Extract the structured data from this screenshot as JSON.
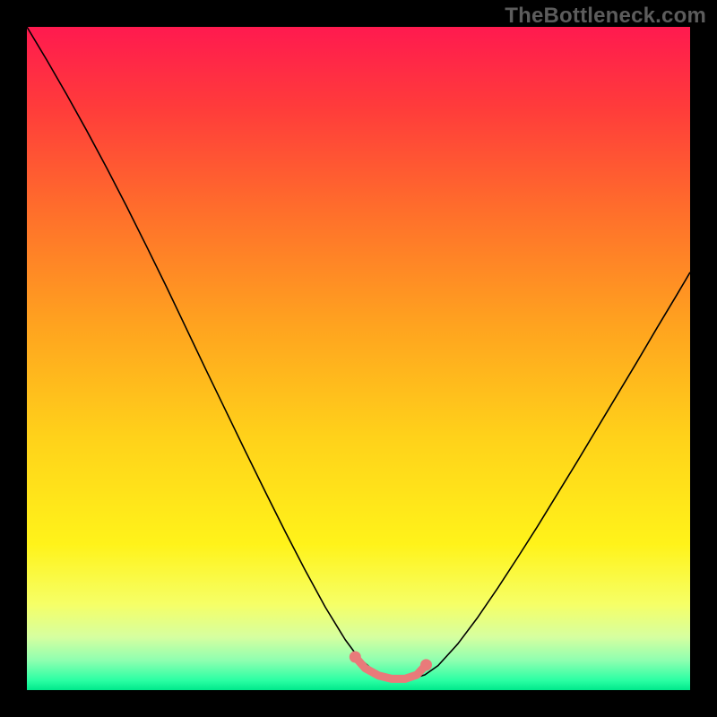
{
  "watermark": "TheBottleneck.com",
  "chart_data": {
    "type": "line",
    "title": "",
    "xlabel": "",
    "ylabel": "",
    "xlim": [
      0,
      100
    ],
    "ylim": [
      0,
      100
    ],
    "grid": false,
    "legend": false,
    "background_gradient": {
      "stops": [
        {
          "offset": 0.0,
          "color": "#ff1a4f"
        },
        {
          "offset": 0.12,
          "color": "#ff3b3b"
        },
        {
          "offset": 0.28,
          "color": "#ff6f2b"
        },
        {
          "offset": 0.45,
          "color": "#ffa31f"
        },
        {
          "offset": 0.62,
          "color": "#ffd21a"
        },
        {
          "offset": 0.78,
          "color": "#fff31a"
        },
        {
          "offset": 0.87,
          "color": "#f6ff66"
        },
        {
          "offset": 0.92,
          "color": "#d6ffa0"
        },
        {
          "offset": 0.955,
          "color": "#8fffb0"
        },
        {
          "offset": 0.985,
          "color": "#2cffa4"
        },
        {
          "offset": 1.0,
          "color": "#00e88b"
        }
      ]
    },
    "series": [
      {
        "name": "bottleneck-curve",
        "stroke": "#000000",
        "stroke_width": 1.6,
        "x": [
          0.0,
          3.0,
          6.0,
          9.0,
          12.0,
          15.0,
          18.0,
          21.0,
          24.0,
          27.0,
          30.0,
          33.0,
          36.0,
          39.0,
          42.0,
          45.0,
          48.0,
          50.0,
          52.0,
          54.0,
          56.0,
          58.0,
          60.0,
          62.0,
          65.0,
          68.0,
          71.0,
          74.0,
          77.0,
          80.0,
          83.0,
          86.0,
          89.0,
          92.0,
          95.0,
          98.0,
          100.0
        ],
        "y": [
          100.0,
          95.0,
          89.8,
          84.4,
          78.8,
          73.0,
          67.0,
          60.9,
          54.6,
          48.3,
          42.1,
          35.9,
          29.8,
          23.8,
          18.0,
          12.5,
          7.6,
          4.9,
          3.2,
          2.2,
          1.7,
          1.7,
          2.3,
          3.7,
          7.0,
          11.0,
          15.4,
          20.0,
          24.7,
          29.6,
          34.5,
          39.5,
          44.5,
          49.5,
          54.6,
          59.6,
          63.0
        ]
      },
      {
        "name": "optimal-range-marker",
        "stroke": "#e97a7a",
        "stroke_width": 9,
        "linecap": "round",
        "markers": true,
        "marker_radius": 6.5,
        "x": [
          49.5,
          51.0,
          53.0,
          55.0,
          57.0,
          58.8,
          60.2
        ],
        "y": [
          5.0,
          3.3,
          2.2,
          1.7,
          1.7,
          2.3,
          3.8
        ]
      }
    ]
  }
}
